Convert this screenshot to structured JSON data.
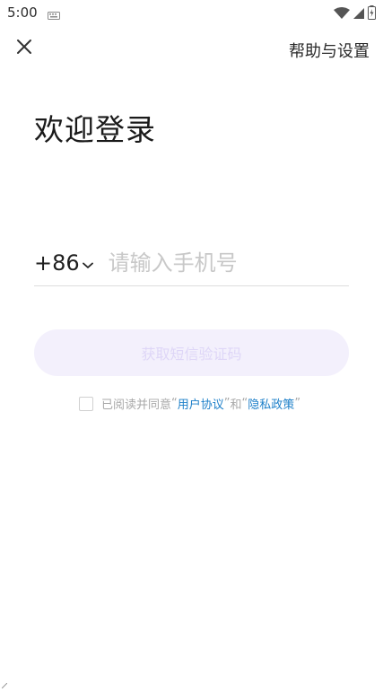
{
  "status_bar": {
    "time": "5:00"
  },
  "header": {
    "help_label": "帮助与设置"
  },
  "title": "欢迎登录",
  "phone": {
    "country_code": "+86",
    "placeholder": "请输入手机号",
    "value": ""
  },
  "sms_button_label": "获取短信验证码",
  "agreement": {
    "prefix": "已阅读并同意",
    "quote_open": "“",
    "quote_close": "”",
    "user_agreement": "用户协议",
    "and": "和",
    "privacy_policy": "隐私政策",
    "checked": false
  },
  "colors": {
    "button_bg": "#f3f0fc",
    "button_text": "#ded6f7",
    "link": "#1e80c9"
  },
  "icons": {
    "close": "close-icon",
    "keyboard": "keyboard-icon",
    "wifi": "wifi-icon",
    "signal": "signal-icon",
    "battery": "battery-icon",
    "chevron": "chevron-down-icon"
  }
}
